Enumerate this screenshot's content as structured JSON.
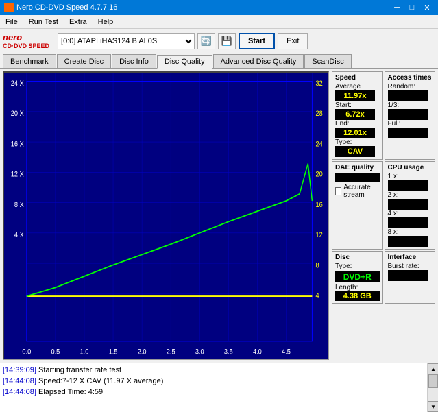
{
  "titlebar": {
    "title": "Nero CD-DVD Speed 4.7.7.16",
    "controls": {
      "minimize": "─",
      "maximize": "□",
      "close": "✕"
    }
  },
  "menubar": {
    "items": [
      "File",
      "Run Test",
      "Extra",
      "Help"
    ]
  },
  "toolbar": {
    "logo_top": "nero",
    "logo_bottom": "CD·DVD SPEED",
    "drive_label": "[0:0]  ATAPI iHAS124  B AL0S",
    "start_label": "Start",
    "exit_label": "Exit"
  },
  "tabs": {
    "items": [
      "Benchmark",
      "Create Disc",
      "Disc Info",
      "Disc Quality",
      "Advanced Disc Quality",
      "ScanDisc"
    ],
    "active": "Disc Quality"
  },
  "speed_panel": {
    "title": "Speed",
    "average_label": "Average",
    "average_value": "11.97x",
    "start_label": "Start:",
    "start_value": "6.72x",
    "end_label": "End:",
    "end_value": "12.01x",
    "type_label": "Type:",
    "type_value": "CAV"
  },
  "access_panel": {
    "title": "Access times",
    "random_label": "Random:",
    "random_value": "",
    "onethird_label": "1/3:",
    "onethird_value": "",
    "full_label": "Full:",
    "full_value": ""
  },
  "dae_panel": {
    "title": "DAE quality",
    "bar_value": "",
    "accurate_label": "Accurate stream"
  },
  "cpu_panel": {
    "title": "CPU usage",
    "1x_label": "1 x:",
    "1x_value": "",
    "2x_label": "2 x:",
    "2x_value": "",
    "4x_label": "4 x:",
    "4x_value": "",
    "8x_label": "8 x:",
    "8x_value": ""
  },
  "disc_panel": {
    "title": "Disc",
    "type_label": "Type:",
    "type_value": "DVD+R",
    "length_label": "Length:",
    "length_value": "4.38 GB"
  },
  "interface_panel": {
    "title": "Interface",
    "burst_label": "Burst rate:",
    "burst_value": ""
  },
  "chart": {
    "y_left_labels": [
      "24 X",
      "20 X",
      "16 X",
      "12 X",
      "8 X",
      "4 X"
    ],
    "y_right_labels": [
      "32",
      "28",
      "24",
      "20",
      "16",
      "12",
      "8",
      "4"
    ],
    "x_labels": [
      "0.0",
      "0.5",
      "1.0",
      "1.5",
      "2.0",
      "2.5",
      "3.0",
      "3.5",
      "4.0",
      "4.5"
    ]
  },
  "log": {
    "rows": [
      {
        "timestamp": "[14:39:09]",
        "text": " Starting transfer rate test"
      },
      {
        "timestamp": "[14:44:08]",
        "text": " Speed:7-12 X CAV (11.97 X average)"
      },
      {
        "timestamp": "[14:44:08]",
        "text": " Elapsed Time: 4:59"
      }
    ]
  }
}
